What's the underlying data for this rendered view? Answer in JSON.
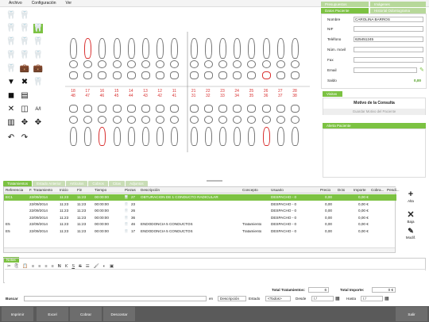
{
  "menu": [
    "Archivo",
    "Configuración",
    "Ver"
  ],
  "chart": {
    "upper_numbers": [
      "18",
      "17",
      "16",
      "15",
      "14",
      "13",
      "12",
      "11",
      "21",
      "22",
      "23",
      "24",
      "25",
      "26",
      "27",
      "28"
    ],
    "lower_numbers": [
      "48",
      "47",
      "46",
      "45",
      "44",
      "43",
      "42",
      "41",
      "31",
      "32",
      "33",
      "34",
      "35",
      "36",
      "37",
      "38"
    ]
  },
  "right_panel": {
    "tab_presupuestos": "Presupuestos",
    "tab_imagenes": "Imágenes",
    "tab_datos": "Datos Paciente",
    "tab_historial": "Historial Odontograma",
    "fields": {
      "nombre_label": "Nombre",
      "nombre_value": "CAROLINA BARROS",
      "nif_label": "NIF",
      "nif_value": "",
      "telefono_label": "Teléfono",
      "telefono_value": "625451245",
      "movil_label": "Núm. movil",
      "movil_value": "",
      "fax_label": "Fax",
      "fax_value": "",
      "email_label": "Email",
      "email_value": "",
      "saldo_label": "Saldo",
      "saldo_value": "0,00"
    },
    "visitas_tab": "Visitas",
    "motivo_header": "Motivo de la Consulta",
    "motivo_button": "Guardar Motivo del Paciente",
    "alerta_tab": "Alerta Paciente"
  },
  "tabs": [
    "Tratamientos",
    "Estado Anterior",
    "Artículos",
    "Cobros",
    "Citas",
    "Adjuntos"
  ],
  "table": {
    "columns": [
      "Referencia",
      "F. Tratamiento",
      "Inicio",
      "Fin",
      "Tiempo",
      "Piezas",
      "Descripción",
      "Concepto",
      "Usuario",
      "Precio",
      "Dcto",
      "Importe",
      "Cobra...",
      "Pendi..."
    ],
    "rows": [
      {
        "ref": "EC1",
        "fecha": "22/09/2014",
        "inicio": "11:23",
        "fin": "11:23",
        "tiempo": "00:00:00",
        "pieza": "27",
        "desc": "OBTURACION DE 1 CONDUCTO RADICULAR",
        "concepto": "",
        "usuario": "DESPACHO - 0",
        "precio": "0,00",
        "dcto": "",
        "importe": "0,00 €",
        "selected": true
      },
      {
        "ref": "",
        "fecha": "22/09/2014",
        "inicio": "11:23",
        "fin": "11:23",
        "tiempo": "00:00:00",
        "pieza": "23",
        "desc": "",
        "concepto": "",
        "usuario": "DESPACHO - 0",
        "precio": "0,00",
        "dcto": "",
        "importe": "0,00 €",
        "selected": false
      },
      {
        "ref": "",
        "fecha": "22/09/2014",
        "inicio": "11:23",
        "fin": "11:23",
        "tiempo": "00:00:00",
        "pieza": "26",
        "desc": "",
        "concepto": "",
        "usuario": "DESPACHO - 0",
        "precio": "0,00",
        "dcto": "",
        "importe": "0,00 €",
        "selected": false
      },
      {
        "ref": "",
        "fecha": "22/09/2014",
        "inicio": "11:23",
        "fin": "11:23",
        "tiempo": "00:00:00",
        "pieza": "36",
        "desc": "",
        "concepto": "",
        "usuario": "DESPACHO - 0",
        "precio": "0,00",
        "dcto": "",
        "importe": "0,00 €",
        "selected": false
      },
      {
        "ref": "E5",
        "fecha": "22/09/2014",
        "inicio": "11:23",
        "fin": "11:23",
        "tiempo": "00:00:00",
        "pieza": "46",
        "desc": "ENDODONCIA 5 CONDUCTOS",
        "concepto": "Tratamiento",
        "usuario": "DESPACHO - 0",
        "precio": "0,00",
        "dcto": "",
        "importe": "0,00 €",
        "selected": false
      },
      {
        "ref": "E5",
        "fecha": "22/09/2014",
        "inicio": "11:23",
        "fin": "11:23",
        "tiempo": "00:00:00",
        "pieza": "17",
        "desc": "ENDODONCIA 5 CONDUCTOS",
        "concepto": "Tratamiento",
        "usuario": "DESPACHO - 0",
        "precio": "0,00",
        "dcto": "",
        "importe": "0,00 €",
        "selected": false
      }
    ]
  },
  "side_buttons": {
    "alta": "Alta",
    "baja": "Baja",
    "modif": "Modif."
  },
  "notas_tab": "Notas",
  "totals": {
    "total_tratamientos_label": "Total Tratamientos:",
    "total_tratamientos_value": "6",
    "total_importe_label": "Total Importe:",
    "total_importe_value": "0 €"
  },
  "search": {
    "buscar_label": "Buscar",
    "en_label": "en",
    "en_value": "Descripción",
    "estado_label": "Estado",
    "estado_value": "<Todos>",
    "desde_label": "Desde",
    "desde_value": "/  /",
    "hasta_label": "Hasta",
    "hasta_value": "/  /"
  },
  "bottom_buttons": {
    "imprimir": "Imprimir",
    "excel": "Excel",
    "cobrar": "Cobrar",
    "descontar": "Descontar",
    "salir": "Salir"
  },
  "colors": {
    "accent": "#7cc242",
    "tooth_mark": "#d93030",
    "bottom_bar": "#5a5a5a"
  }
}
